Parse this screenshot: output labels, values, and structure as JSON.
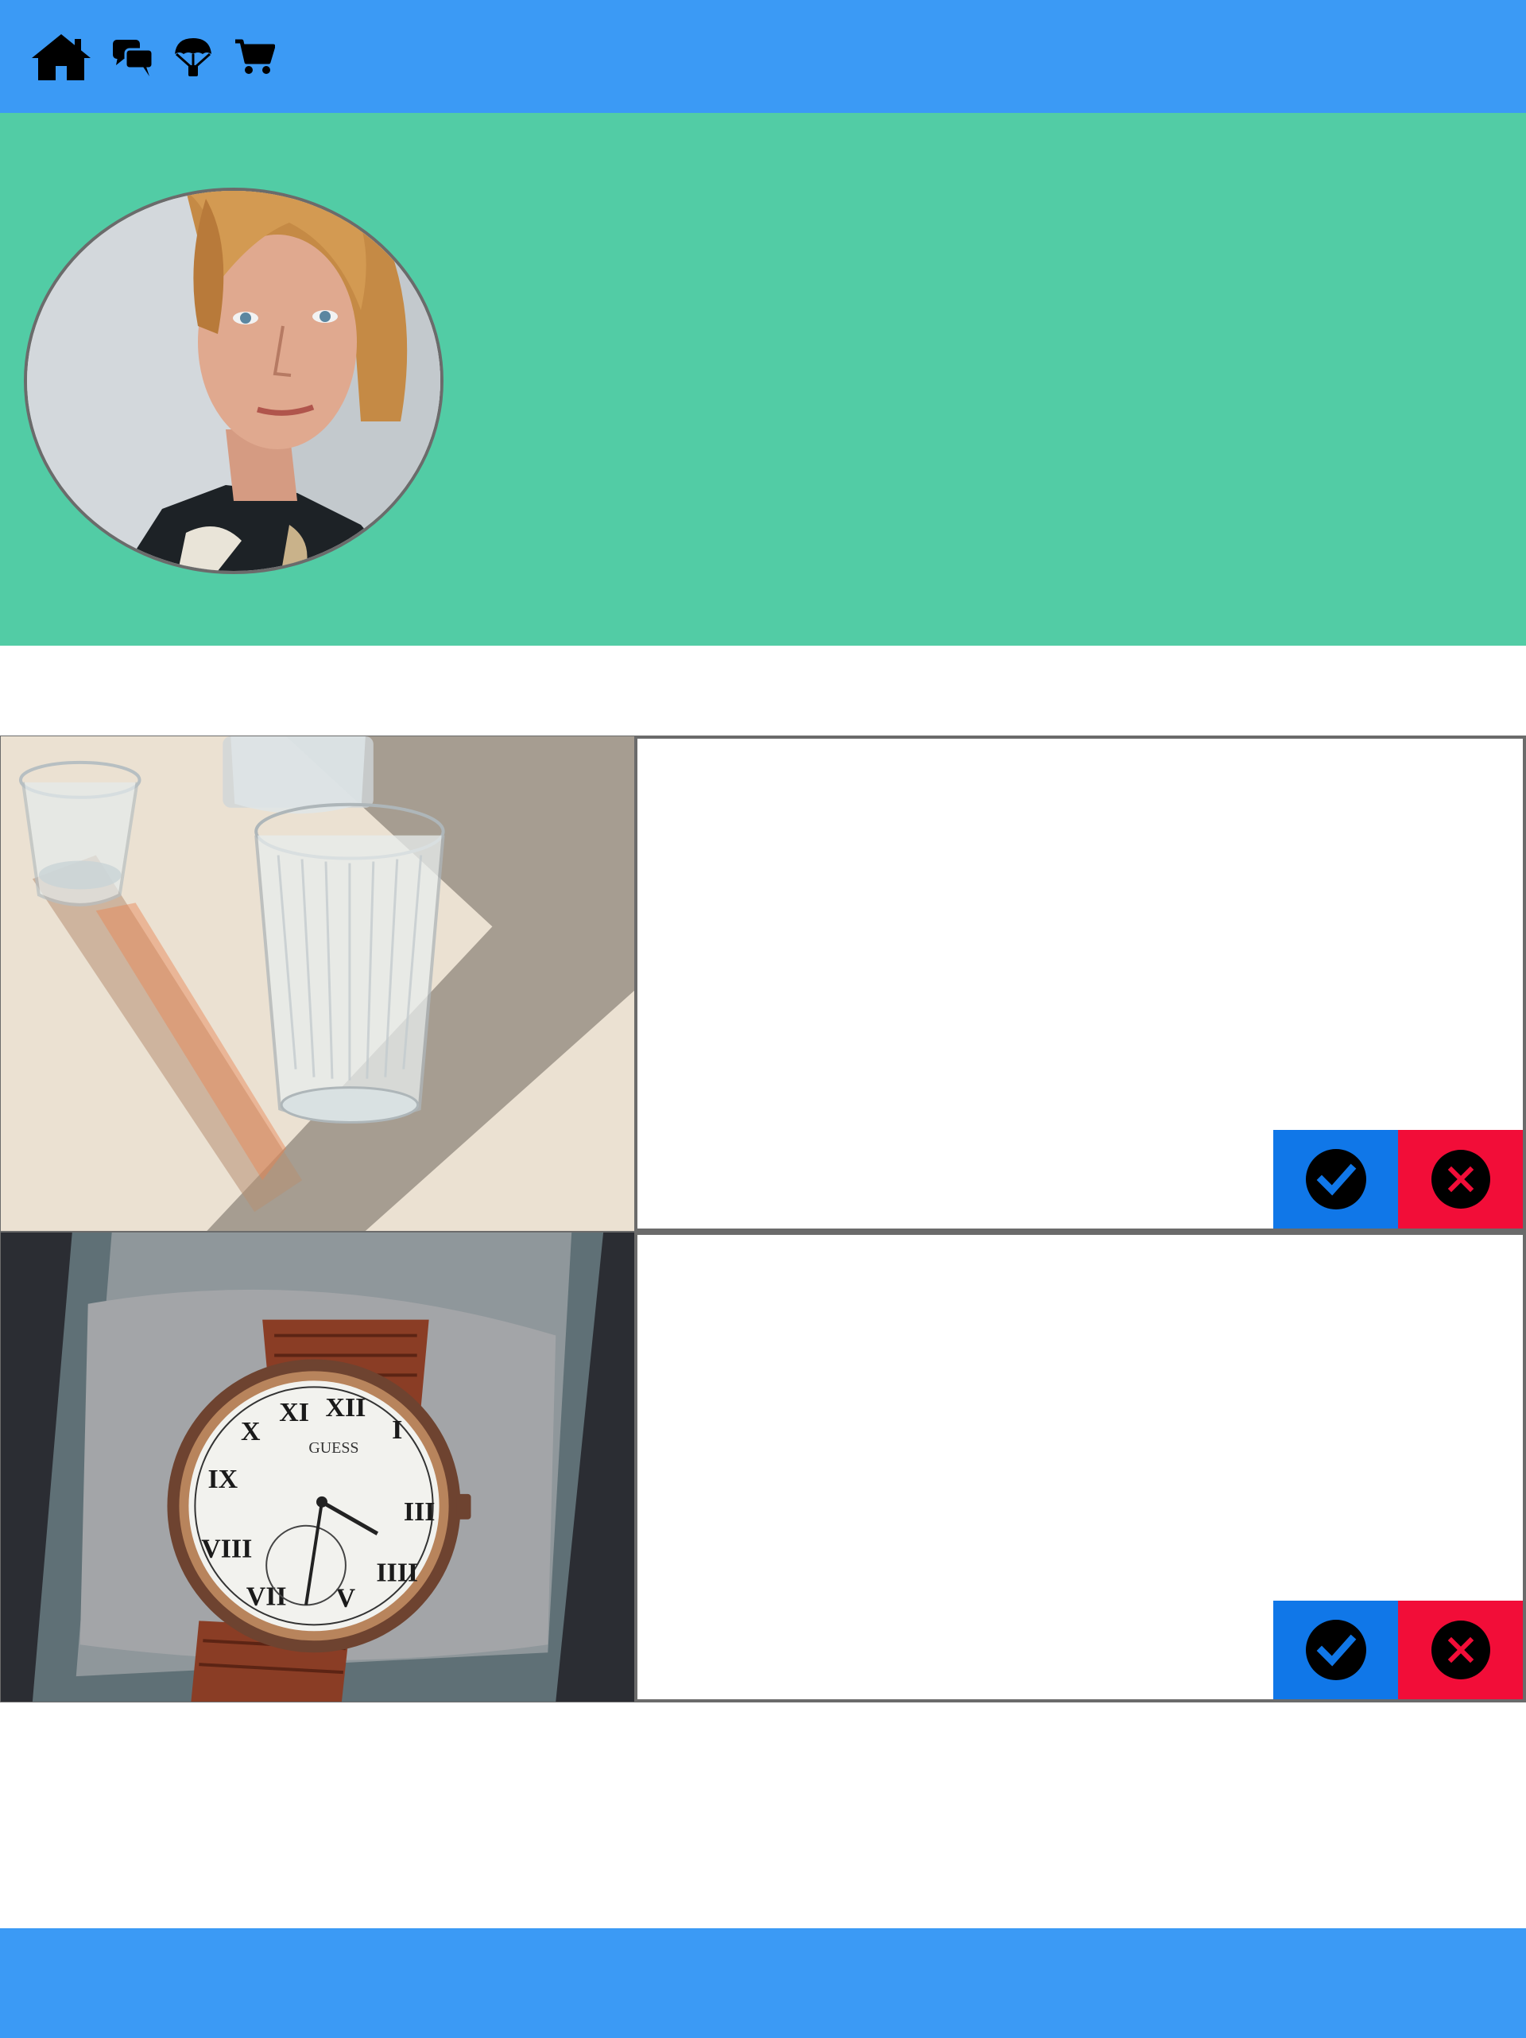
{
  "colors": {
    "header_bg": "#3b9af5",
    "hero_bg": "#52cca5",
    "accept_bg": "#1077e8",
    "reject_bg": "#f20d38",
    "border": "#6b6b6b",
    "icon": "#000000"
  },
  "nav": {
    "items": [
      {
        "icon": "home-icon"
      },
      {
        "icon": "chat-bubbles-icon"
      },
      {
        "icon": "parachute-icon"
      },
      {
        "icon": "shopping-cart-icon"
      }
    ]
  },
  "profile": {
    "avatar": "profile-photo"
  },
  "cards": [
    {
      "image": "water-glasses-photo",
      "accept_icon": "check-circle-icon",
      "reject_icon": "close-circle-icon"
    },
    {
      "image": "wristwatch-photo",
      "watch_brand": "GUESS",
      "accept_icon": "check-circle-icon",
      "reject_icon": "close-circle-icon"
    }
  ]
}
